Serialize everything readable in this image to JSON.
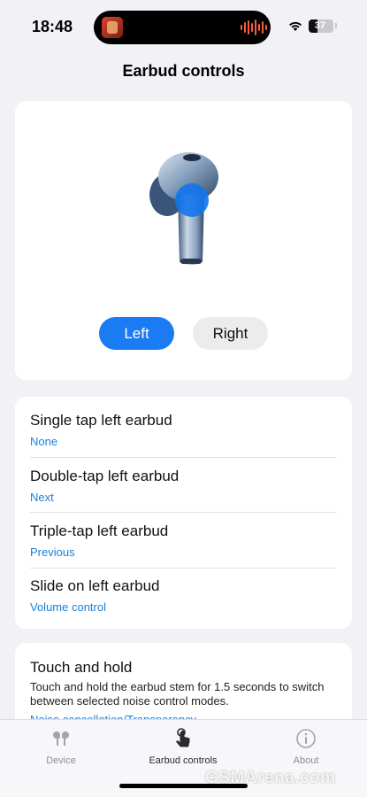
{
  "status_bar": {
    "time": "18:48",
    "battery": "37",
    "battery_level": 0.37
  },
  "header": {
    "title": "Earbud controls"
  },
  "product": {
    "segment": {
      "left_label": "Left",
      "right_label": "Right",
      "selected": "Left"
    }
  },
  "controls": [
    {
      "title": "Single tap left earbud",
      "value": "None"
    },
    {
      "title": "Double-tap left earbud",
      "value": "Next"
    },
    {
      "title": "Triple-tap left earbud",
      "value": "Previous"
    },
    {
      "title": "Slide on left earbud",
      "value": "Volume control"
    }
  ],
  "touch_hold": {
    "title": "Touch and hold",
    "description": "Touch and hold the earbud stem for 1.5 seconds to switch between selected noise control modes.",
    "value": "Noise cancellation/Transparency"
  },
  "tab_bar": {
    "tabs": [
      {
        "label": "Device",
        "icon": "earbuds-icon"
      },
      {
        "label": "Earbud controls",
        "icon": "tap-hand-icon",
        "active": true
      },
      {
        "label": "About",
        "icon": "info-icon"
      }
    ]
  },
  "watermark": "GSMArena.com",
  "colors": {
    "accent": "#1a7bf2",
    "link": "#1a7fd8",
    "background": "#f2f2f6"
  }
}
